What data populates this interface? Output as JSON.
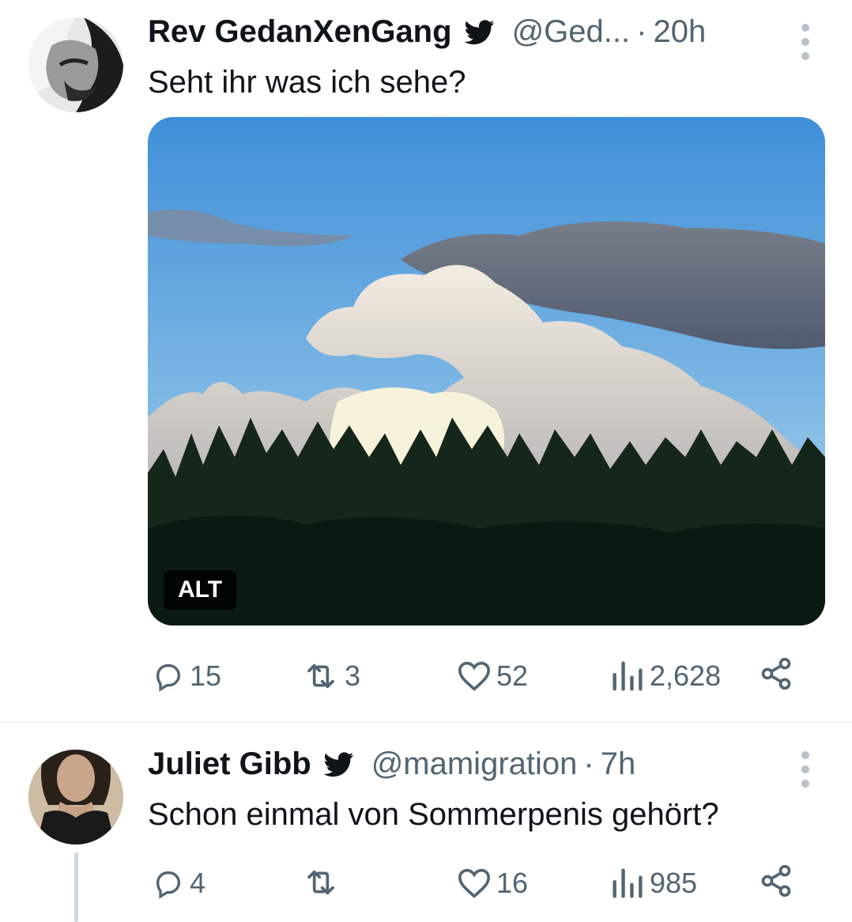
{
  "tweets": [
    {
      "name": "Rev GedanXenGang",
      "handle": "@Ged...",
      "dot": "·",
      "time": "20h",
      "text": "Seht ihr was ich sehe?",
      "media_alt_badge": "ALT",
      "replies": "15",
      "retweets": "3",
      "likes": "52",
      "views": "2,628"
    },
    {
      "name": "Juliet Gibb",
      "handle": "@mamigration",
      "dot": "·",
      "time": "7h",
      "text": "Schon einmal von Sommerpenis gehört?",
      "replies": "4",
      "retweets": "",
      "likes": "16",
      "views": "985"
    }
  ],
  "icons": {
    "verified": "twitter-bird-icon",
    "reply": "reply-icon",
    "retweet": "retweet-icon",
    "like": "heart-icon",
    "views": "views-icon",
    "share": "share-icon",
    "more": "more-vertical-icon"
  },
  "colors": {
    "text": "#0f1419",
    "secondary": "#536471",
    "twitter_blue": "#1d9bf0"
  }
}
